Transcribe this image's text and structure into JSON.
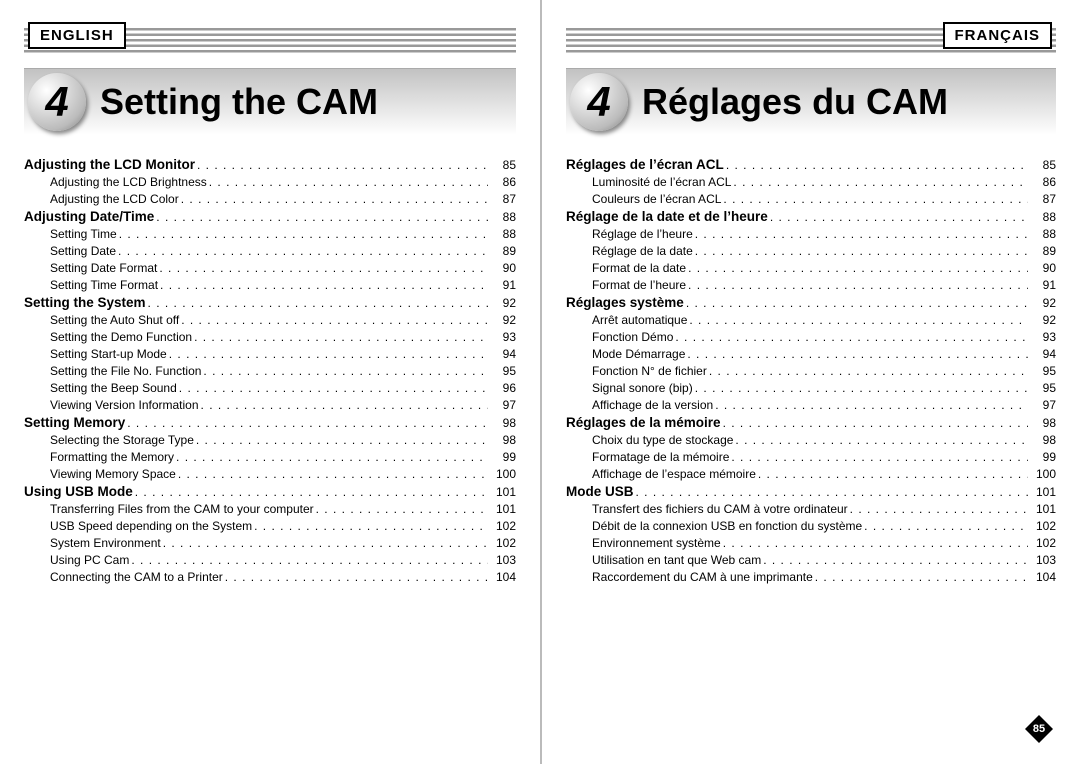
{
  "left": {
    "lang": "ENGLISH",
    "chapter_number": "4",
    "chapter_title": "Setting the CAM",
    "toc": [
      {
        "type": "section",
        "label": "Adjusting the LCD Monitor",
        "page": "85"
      },
      {
        "type": "sub",
        "label": "Adjusting the LCD Brightness",
        "page": "86"
      },
      {
        "type": "sub",
        "label": "Adjusting the LCD Color",
        "page": "87"
      },
      {
        "type": "section",
        "label": "Adjusting Date/Time",
        "page": "88"
      },
      {
        "type": "sub",
        "label": "Setting Time",
        "page": "88"
      },
      {
        "type": "sub",
        "label": "Setting Date",
        "page": "89"
      },
      {
        "type": "sub",
        "label": "Setting Date Format",
        "page": "90"
      },
      {
        "type": "sub",
        "label": "Setting Time Format",
        "page": "91"
      },
      {
        "type": "section",
        "label": "Setting the System",
        "page": "92"
      },
      {
        "type": "sub",
        "label": "Setting the Auto Shut off",
        "page": "92"
      },
      {
        "type": "sub",
        "label": "Setting the Demo Function",
        "page": "93"
      },
      {
        "type": "sub",
        "label": "Setting Start-up Mode",
        "page": "94"
      },
      {
        "type": "sub",
        "label": "Setting the File No. Function",
        "page": "95"
      },
      {
        "type": "sub",
        "label": "Setting the Beep Sound",
        "page": "96"
      },
      {
        "type": "sub",
        "label": "Viewing Version Information",
        "page": "97"
      },
      {
        "type": "section",
        "label": "Setting Memory",
        "page": "98"
      },
      {
        "type": "sub",
        "label": "Selecting the Storage Type",
        "page": "98"
      },
      {
        "type": "sub",
        "label": "Formatting the Memory",
        "page": "99"
      },
      {
        "type": "sub",
        "label": "Viewing Memory Space",
        "page": "100"
      },
      {
        "type": "section",
        "label": "Using USB Mode",
        "page": "101"
      },
      {
        "type": "sub",
        "label": "Transferring Files from the CAM to your computer",
        "page": "101"
      },
      {
        "type": "sub",
        "label": "USB Speed depending on the System",
        "page": "102"
      },
      {
        "type": "sub",
        "label": "System Environment",
        "page": "102"
      },
      {
        "type": "sub",
        "label": "Using PC Cam",
        "page": "103"
      },
      {
        "type": "sub",
        "label": "Connecting the CAM to a Printer",
        "page": "104"
      }
    ]
  },
  "right": {
    "lang": "FRANÇAIS",
    "chapter_number": "4",
    "chapter_title": "Réglages du CAM",
    "toc": [
      {
        "type": "section",
        "label": "Réglages de l’écran ACL",
        "page": "85"
      },
      {
        "type": "sub",
        "label": "Luminosité de l’écran ACL",
        "page": "86"
      },
      {
        "type": "sub",
        "label": "Couleurs de l’écran ACL",
        "page": "87"
      },
      {
        "type": "section",
        "label": "Réglage de la date et de l’heure",
        "page": "88"
      },
      {
        "type": "sub",
        "label": "Réglage de l’heure",
        "page": "88"
      },
      {
        "type": "sub",
        "label": "Réglage de la date",
        "page": "89"
      },
      {
        "type": "sub",
        "label": "Format de la date",
        "page": "90"
      },
      {
        "type": "sub",
        "label": "Format de l’heure",
        "page": "91"
      },
      {
        "type": "section",
        "label": "Réglages système",
        "page": "92"
      },
      {
        "type": "sub",
        "label": "Arrêt automatique",
        "page": "92"
      },
      {
        "type": "sub",
        "label": "Fonction Démo",
        "page": "93"
      },
      {
        "type": "sub",
        "label": "Mode Démarrage",
        "page": "94"
      },
      {
        "type": "sub",
        "label": "Fonction N° de fichier",
        "page": "95"
      },
      {
        "type": "sub",
        "label": "Signal sonore (bip)",
        "page": "95"
      },
      {
        "type": "sub",
        "label": "Affichage de la version",
        "page": "97"
      },
      {
        "type": "section",
        "label": "Réglages de la mémoire",
        "page": "98"
      },
      {
        "type": "sub",
        "label": "Choix du type de stockage",
        "page": "98"
      },
      {
        "type": "sub",
        "label": "Formatage de la mémoire",
        "page": "99"
      },
      {
        "type": "sub",
        "label": "Affichage de l’espace mémoire",
        "page": "100"
      },
      {
        "type": "section",
        "label": "Mode USB",
        "page": "101"
      },
      {
        "type": "sub",
        "label": "Transfert des fichiers du CAM à votre ordinateur",
        "page": "101"
      },
      {
        "type": "sub",
        "label": "Débit de la connexion USB en fonction du système",
        "page": "102"
      },
      {
        "type": "sub",
        "label": "Environnement système",
        "page": "102"
      },
      {
        "type": "sub",
        "label": "Utilisation en tant que Web cam",
        "page": "103"
      },
      {
        "type": "sub",
        "label": "Raccordement du CAM à une imprimante",
        "page": "104"
      }
    ],
    "page_badge": "85"
  }
}
